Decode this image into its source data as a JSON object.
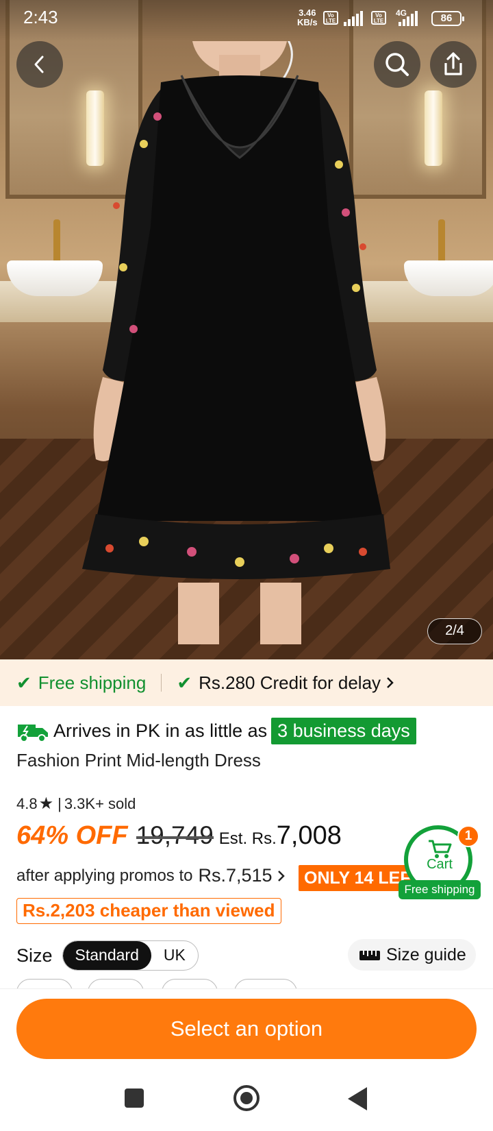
{
  "status_bar": {
    "time": "2:43",
    "net_speed": "3.46",
    "net_unit": "KB/s",
    "network": "4G",
    "battery": "86"
  },
  "gallery": {
    "counter": "2/4",
    "icons": [
      "back-arrow-icon",
      "search-icon",
      "share-icon"
    ]
  },
  "shipping_strip": {
    "free_shipping": "Free shipping",
    "credit": "Rs.280 Credit for delay"
  },
  "delivery": {
    "prefix": "Arrives in PK in as little as",
    "highlight": "3 business days"
  },
  "product": {
    "title": "Fashion Print Mid-length Dress",
    "rating": "4.8",
    "sold": "3.3K+ sold"
  },
  "price": {
    "discount": "64% OFF",
    "original": "19,749",
    "est_label": "Est. Rs.",
    "est_value": "7,008",
    "promo_label": "after applying promos to",
    "promo_value": "Rs.7,515",
    "stock_badge": "ONLY 14 LEFT",
    "cheaper_note": "Rs.2,203 cheaper than viewed"
  },
  "cart": {
    "label": "Cart",
    "count": "1",
    "free_shipping": "Free shipping"
  },
  "size": {
    "label": "Size",
    "options": [
      "Standard",
      "UK"
    ],
    "selected": "Standard",
    "guide": "Size guide"
  },
  "cta": {
    "label": "Select an option"
  },
  "colors": {
    "accent": "#ff7a0d",
    "green": "#13a13a",
    "strip_bg": "#fdf0e2"
  }
}
